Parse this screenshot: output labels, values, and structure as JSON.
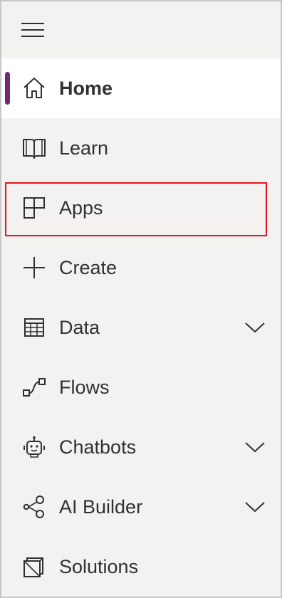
{
  "menu": {
    "icon": "hamburger-icon"
  },
  "nav": {
    "items": [
      {
        "label": "Home",
        "icon": "home-icon"
      },
      {
        "label": "Learn",
        "icon": "book-icon"
      },
      {
        "label": "Apps",
        "icon": "apps-icon"
      },
      {
        "label": "Create",
        "icon": "plus-icon"
      },
      {
        "label": "Data",
        "icon": "table-icon"
      },
      {
        "label": "Flows",
        "icon": "flow-icon"
      },
      {
        "label": "Chatbots",
        "icon": "bot-icon"
      },
      {
        "label": "AI Builder",
        "icon": "ai-builder-icon"
      },
      {
        "label": "Solutions",
        "icon": "solutions-icon"
      }
    ]
  },
  "colors": {
    "panel_bg": "#f3f2f1",
    "active_bg": "#ffffff",
    "active_indicator": "#742774",
    "highlight_border": "#e81123",
    "text": "#323130"
  }
}
